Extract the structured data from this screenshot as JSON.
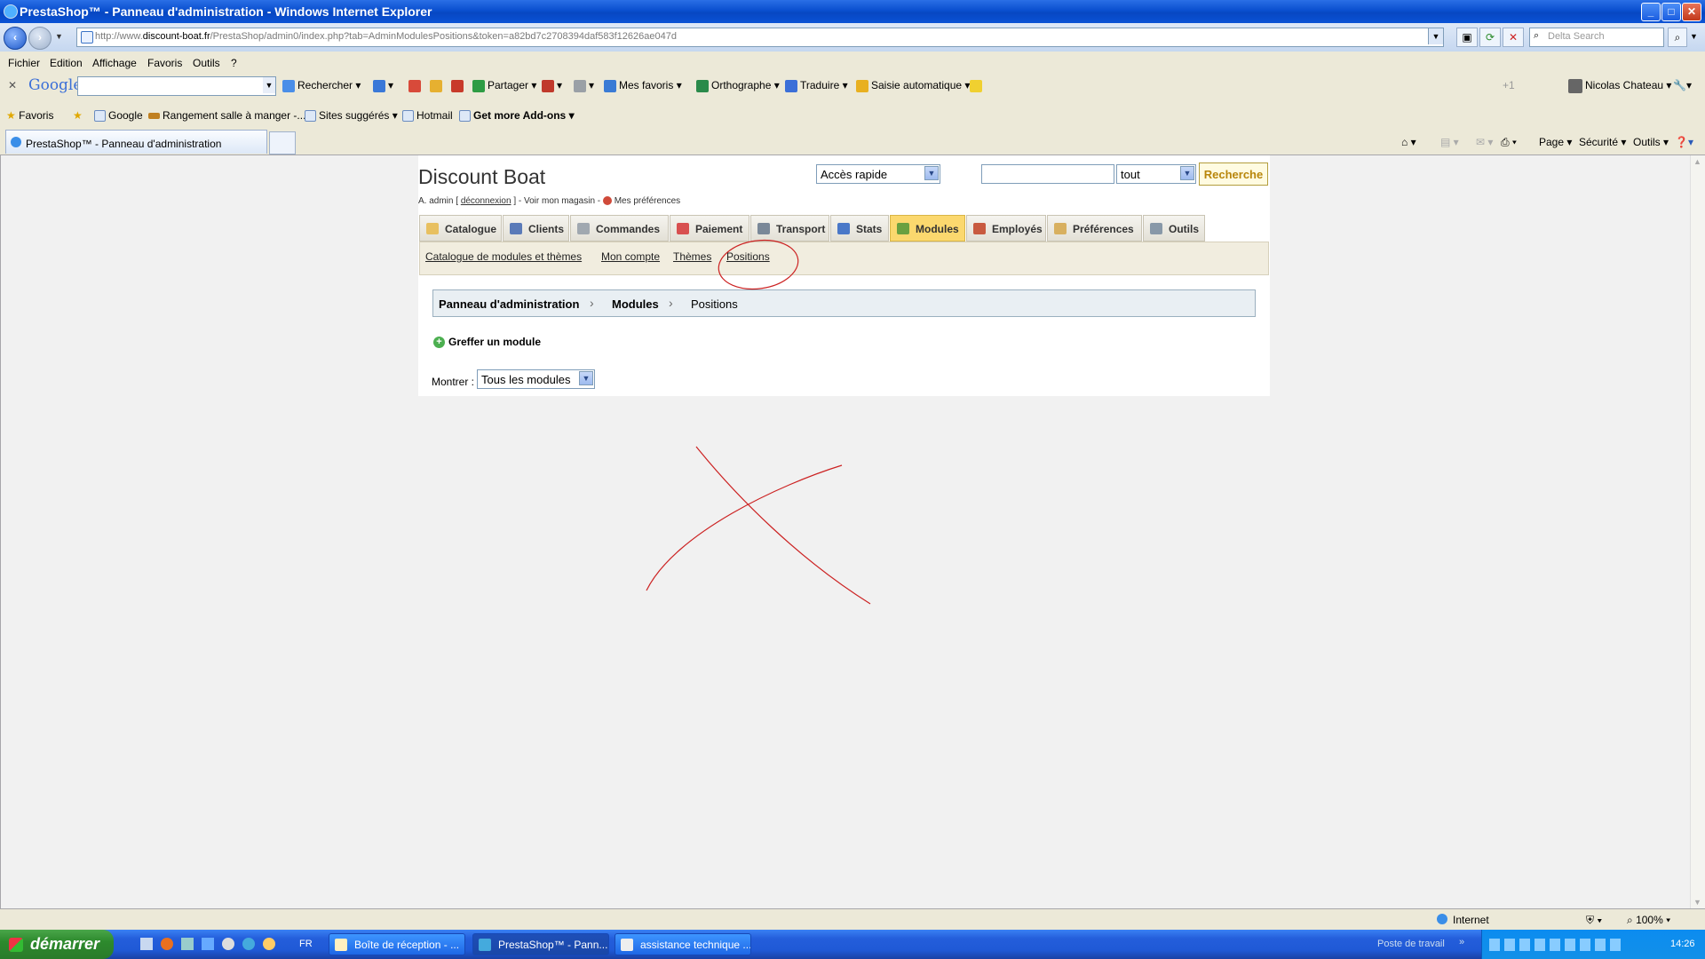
{
  "window": {
    "title": "PrestaShop™ - Panneau d'administration - Windows Internet Explorer",
    "controls": [
      "_",
      "□",
      "✕"
    ]
  },
  "address": {
    "url_prefix": "http://www.",
    "url_domain": "discount-boat.fr",
    "url_rest": "/PrestaShop/admin0/index.php?tab=AdminModulesPositions&token=a82bd7c2708394daf583f12626ae047d",
    "search_placeholder": "Delta Search"
  },
  "menu": [
    "Fichier",
    "Edition",
    "Affichage",
    "Favoris",
    "Outils",
    "?"
  ],
  "google_toolbar": {
    "logo": "Google",
    "items": [
      "Rechercher",
      "Partager",
      "Mes favoris",
      "Orthographe",
      "Traduire",
      "Saisie automatique"
    ],
    "user": "Nicolas Chateau"
  },
  "favorites": {
    "label": "Favoris",
    "items": [
      "Google",
      "Rangement salle à manger -...",
      "Sites suggérés",
      "Hotmail",
      "Get more Add-ons"
    ]
  },
  "tab": {
    "title": "PrestaShop™ - Panneau d'administration",
    "commands": [
      "Page",
      "Sécurité",
      "Outils"
    ]
  },
  "shop": {
    "name": "Discount Boat",
    "user_prefix": "A. admin [",
    "logout": "déconnexion",
    "user_mid": "] - Voir mon magasin -",
    "prefs": "Mes préférences",
    "quick_access": "Accès rapide",
    "search_scope": "tout",
    "search_button": "Recherche"
  },
  "main_tabs": [
    "Catalogue",
    "Clients",
    "Commandes",
    "Paiement",
    "Transport",
    "Stats",
    "Modules",
    "Employés",
    "Préférences",
    "Outils"
  ],
  "active_tab": "Modules",
  "sub_tabs": [
    "Catalogue de modules et thèmes",
    "Mon compte",
    "Thèmes",
    "Positions"
  ],
  "breadcrumb": [
    "Panneau d'administration",
    "Modules",
    "Positions"
  ],
  "greffer": "Greffer un module",
  "montrer": {
    "label": "Montrer :",
    "value": "Tous les modules"
  },
  "status": {
    "zone": "Internet",
    "zoom": "100%"
  },
  "taskbar": {
    "start": "démarrer",
    "lang": "FR",
    "tasks": [
      "Boîte de réception - ...",
      "PrestaShop™ - Pann...",
      "assistance technique ..."
    ],
    "tray_label": "Poste de travail",
    "clock": "14:26"
  },
  "colors": {
    "annotation": "#cc2222",
    "active_tab": "#fbd86e"
  }
}
